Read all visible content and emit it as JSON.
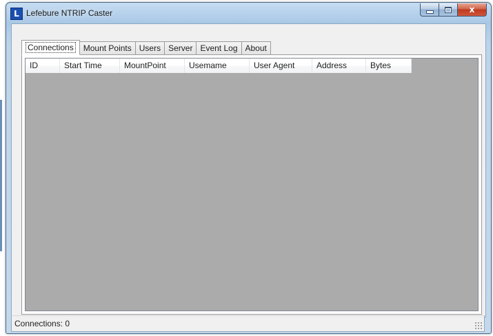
{
  "window": {
    "title": "Lefebure NTRIP Caster",
    "icon_letter": "L",
    "icon_color": "#1a4fb0"
  },
  "caption": {
    "close_label": "x"
  },
  "tabs": [
    {
      "label": "Connections",
      "active": true
    },
    {
      "label": "Mount Points",
      "active": false
    },
    {
      "label": "Users",
      "active": false
    },
    {
      "label": "Server",
      "active": false
    },
    {
      "label": "Event Log",
      "active": false
    },
    {
      "label": "About",
      "active": false
    }
  ],
  "connections_table": {
    "columns": [
      "ID",
      "Start Time",
      "MountPoint",
      "Usemame",
      "User Agent",
      "Address",
      "Bytes"
    ],
    "rows": [],
    "background_color": "#ababab"
  },
  "status": {
    "text": "Connections: 0"
  }
}
